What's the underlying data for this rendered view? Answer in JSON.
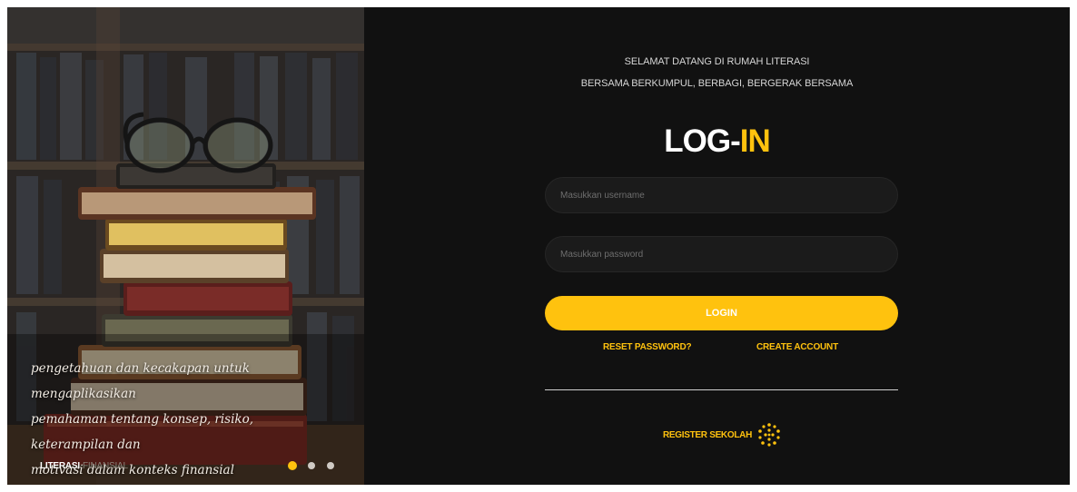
{
  "hero": {
    "caption_line1": "pengetahuan dan kecakapan untuk mengaplikasikan",
    "caption_line2": "pemahaman tentang konsep, risiko, keterampilan dan",
    "caption_line3": "motivasi dalam konteks finansial",
    "brand_primary": "LITERASI",
    "brand_secondary": "FINANSIAL",
    "slides": {
      "count": 3,
      "active_index": 0
    },
    "image_icon": "stack-of-books-with-glasses"
  },
  "login": {
    "welcome_line1": "SELAMAT DATANG DI RUMAH LITERASI",
    "welcome_line2": "BERSAMA BERKUMPUL, BERBAGI, BERGERAK BERSAMA",
    "title_part1": "LOG-",
    "title_part2": "IN",
    "username_placeholder": "Masukkan username",
    "password_placeholder": "Masukkan password",
    "login_button": "LOGIN",
    "reset_password": "RESET PASSWORD?",
    "create_account": "CREATE ACCOUNT",
    "register_school": "REGISTER SEKOLAH",
    "register_icon": "dotted-circle-icon"
  },
  "colors": {
    "accent": "#ffc20e",
    "background": "#111111",
    "input_bg": "#1b1b1b",
    "text_muted": "#d6d6d6"
  }
}
